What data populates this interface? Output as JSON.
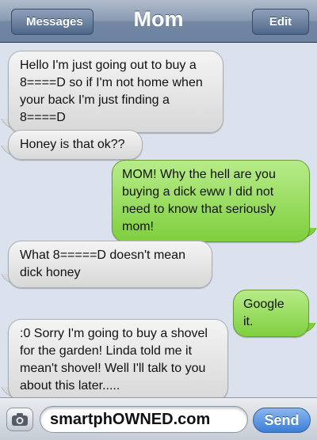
{
  "header": {
    "back_label": "Messages",
    "title": "Mom",
    "edit_label": "Edit"
  },
  "messages": [
    {
      "direction": "in",
      "text": "Hello I'm just going out to buy a 8====D so if I'm not home when your back I'm just finding a 8====D"
    },
    {
      "direction": "in",
      "text": "Honey is that ok??"
    },
    {
      "direction": "out",
      "text": "MOM! Why the hell are you buying a dick eww I did not need to know that seriously mom!"
    },
    {
      "direction": "in",
      "text": "What 8=====D doesn't mean dick honey"
    },
    {
      "direction": "out",
      "text": "Google it."
    },
    {
      "direction": "in",
      "text": ":0 Sorry I'm going to buy a shovel for the garden! Linda told me it mean't shovel! Well I'll talk to you about this later....."
    }
  ],
  "composer": {
    "camera_icon": "camera-icon",
    "input_value": "smartphOWNED.com",
    "send_label": "Send"
  },
  "colors": {
    "incoming_bubble": "#e6e6e6",
    "outgoing_bubble": "#9bdd62",
    "send_button": "#3b7ed8",
    "background": "#dbe2ed"
  }
}
